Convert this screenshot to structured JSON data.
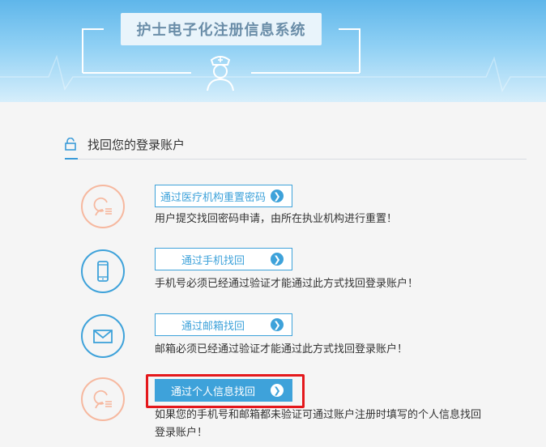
{
  "header": {
    "title": "护士电子化注册信息系统"
  },
  "section": {
    "title": "找回您的登录账户"
  },
  "options": [
    {
      "button_label": "通过医疗机构重置密码",
      "description": "用户提交找回密码申请，由所在执业机构进行重置！",
      "icon": "user-reset-icon"
    },
    {
      "button_label": "通过手机找回",
      "description": "手机号必须已经通过验证才能通过此方式找回登录账户！",
      "icon": "mobile-phone-icon"
    },
    {
      "button_label": "通过邮箱找回",
      "description": "邮箱必须已经通过验证才能通过此方式找回登录账户！",
      "icon": "envelope-icon"
    },
    {
      "button_label": "通过个人信息找回",
      "description_line1": "如果您的手机号和邮箱都未验证可通过账户注册时填写的个人信息找回",
      "description_line2": "登录账户！",
      "icon": "user-info-icon"
    }
  ],
  "colors": {
    "accent": "#3ea2da",
    "orange": "#f6b89f",
    "highlight": "#e4181c"
  }
}
